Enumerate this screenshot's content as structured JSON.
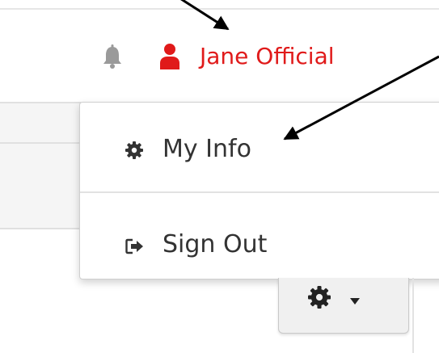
{
  "header": {
    "notifications_icon": "bell-icon",
    "user_icon": "user-icon",
    "user_name": "Jane Official"
  },
  "user_menu": {
    "items": [
      {
        "label": "My Info",
        "icon": "gear-icon"
      },
      {
        "label": "Sign Out",
        "icon": "sign-out-icon"
      }
    ]
  },
  "settings_button": {
    "icons": [
      "gear-icon",
      "caret-down-icon"
    ]
  },
  "colors": {
    "user_accent": "#e01a1a",
    "menu_text": "#333333",
    "icon_gray": "#9a9a9a",
    "annotation_arrow": "#000000"
  }
}
